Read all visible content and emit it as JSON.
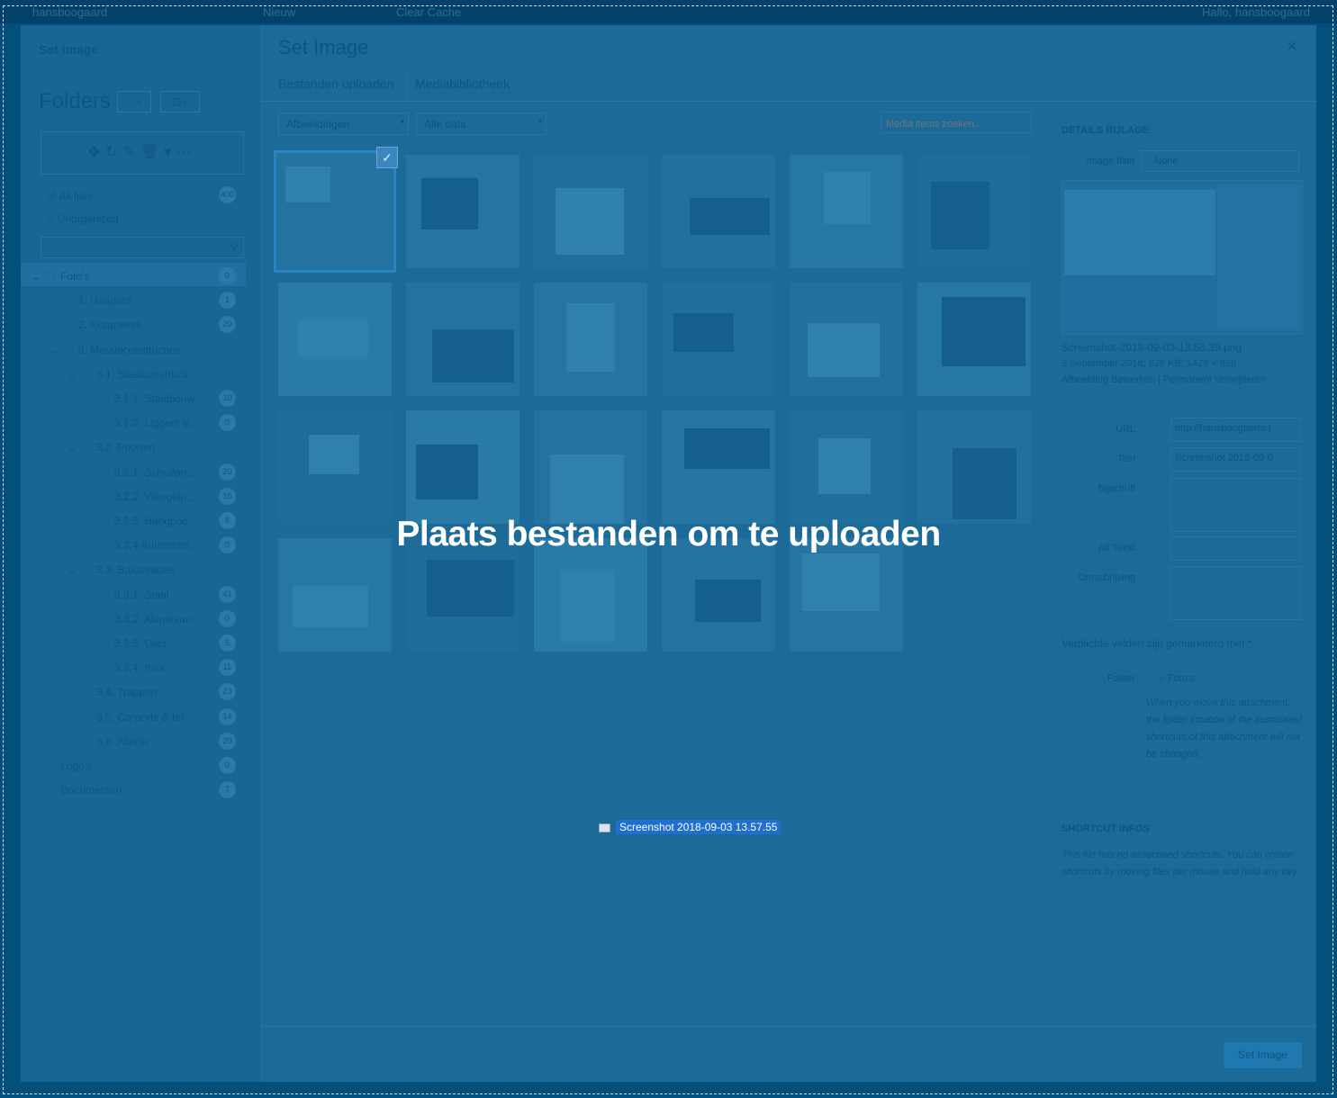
{
  "topbar": {
    "site": "hansboogaard",
    "new": "Nieuw",
    "clear": "Clear Cache",
    "user": "Hallo, hansboogaard"
  },
  "sidebar": {
    "title": "Set Image",
    "folders_heading": "Folders",
    "new_folder_btn": "🗀+",
    "new_item_btn": "⊡+",
    "all_files": "All files",
    "all_files_count": "400",
    "unorganized": "Unorganized",
    "tree": [
      {
        "label": "Foto's",
        "count": "0"
      },
      {
        "label": "1. Headers",
        "count": "1"
      },
      {
        "label": "2. Kraanwerk",
        "count": "29"
      },
      {
        "label": "3. Metaalconstructies",
        "count": ""
      },
      {
        "label": "3.1. Staalconstructi...",
        "count": ""
      },
      {
        "label": "3.1.1. Staalbouw",
        "count": "10"
      },
      {
        "label": "3.1.2. Liggers e...",
        "count": "0"
      },
      {
        "label": "3.2. Poorten",
        "count": ""
      },
      {
        "label": "3.2.1. Schuifpo...",
        "count": "20"
      },
      {
        "label": "3.2.2. Vleugelp...",
        "count": "16"
      },
      {
        "label": "3.2.3. Hangpoo...",
        "count": "8"
      },
      {
        "label": "3.2.4 Automatis...",
        "count": "0"
      },
      {
        "label": "3.3. Balustrades",
        "count": ""
      },
      {
        "label": "3.3.1. Staal",
        "count": "41"
      },
      {
        "label": "3.3.2. Aluminium",
        "count": "0"
      },
      {
        "label": "3.3.3. Glas",
        "count": "5"
      },
      {
        "label": "3.3.4. Inox",
        "count": "11"
      },
      {
        "label": "3.4. Trappen",
        "count": "23"
      },
      {
        "label": "3.5. Carports & ter...",
        "count": "14"
      },
      {
        "label": "3.6. Allerlei",
        "count": "20"
      },
      {
        "label": "Logo's",
        "count": "0"
      },
      {
        "label": "Documenten",
        "count": "7"
      }
    ]
  },
  "main": {
    "title": "Set Image",
    "close": "×",
    "tabs": [
      {
        "label": "Bestanden uploaden"
      },
      {
        "label": "Mediabibliotheek"
      }
    ],
    "filter_type": "Afbeeldingen",
    "filter_date": "Alle data",
    "search_placeholder": "Media items zoeken...",
    "set_button": "Set Image"
  },
  "details": {
    "heading": "DETAILS BIJLAGE",
    "image_filter_label": "Image filter",
    "image_filter_value": "None",
    "filename": "Screenshot-2018-09-03-13.58.39.png",
    "meta": "3 September 2018; 828 KB; 1428 × 926",
    "edit_link": "Afbeelding Bewerken",
    "delete_link": "Permanent Verwijderen",
    "url_label": "URL",
    "url_value": "http://hansboogaerts.t",
    "title_label": "Titel",
    "title_value": "Screenshot 2018-09-0",
    "caption_label": "Bijschrift",
    "alt_label": "Alt Tekst",
    "desc_label": "Omschrijving",
    "required_note": "Verplichte velden zijn gemarkeerd met *",
    "folder_label": "Folder",
    "folder_value": "Foto's",
    "folder_note": "When you move this attachment, the folder location of the associated shortcuts of this attachment will not be changed.",
    "shortcut_heading": "SHORTCUT INFOS",
    "shortcut_text": "This file has no associated shortcuts. You can create shortcuts by moving files per mouse and hold any key."
  },
  "overlay": {
    "drop_text": "Plaats bestanden om te uploaden",
    "drag_file": "Screenshot 2018-09-03 13.57.55"
  },
  "colors": {
    "overlay": "#1b6a98",
    "text_dim": "#0d5682",
    "drag_highlight": "#1f6fd1"
  }
}
